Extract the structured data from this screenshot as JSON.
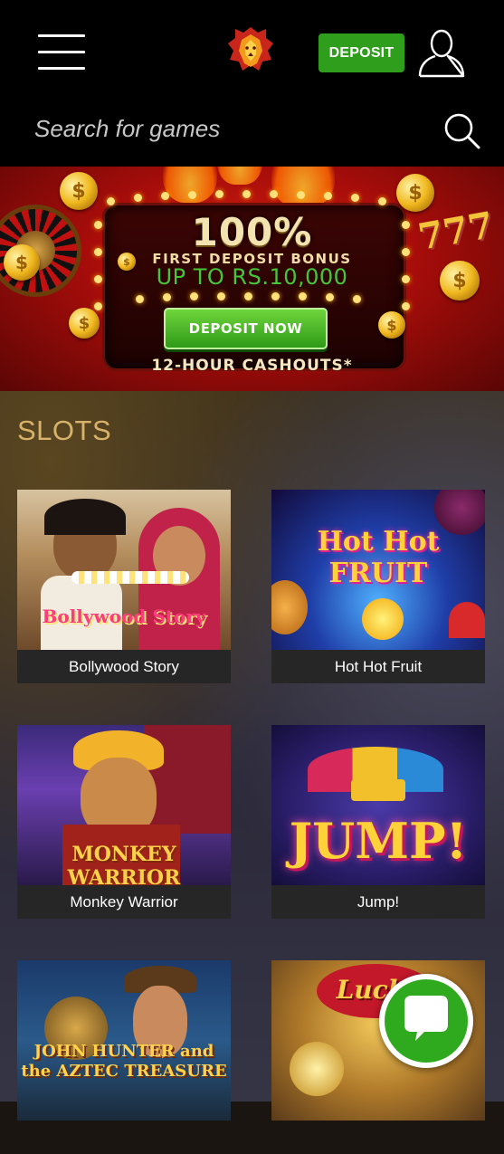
{
  "header": {
    "menu_icon": "hamburger-menu-icon",
    "logo_icon": "lion-logo-icon",
    "deposit_label": "DEPOSIT",
    "user_icon": "user-profile-icon",
    "search_placeholder": "Search for games",
    "search_icon": "search-icon"
  },
  "banner": {
    "headline": "100%",
    "subheadline": "FIRST DEPOSIT BONUS",
    "amount": "UP TO RS.10,000",
    "cta_label": "DEPOSIT NOW",
    "footer": "12-HOUR CASHOUTS*",
    "colors": {
      "background": "#b8120c",
      "cta": "#3faf22",
      "amount": "#46c63a"
    }
  },
  "slots": {
    "title": "SLOTS",
    "games": [
      {
        "name": "Bollywood Story",
        "thumb_text": "Bollywood Story"
      },
      {
        "name": "Hot Hot Fruit",
        "thumb_text": "Hot Hot FRUIT"
      },
      {
        "name": "Monkey Warrior",
        "thumb_text": "MONKEY WARRIOR"
      },
      {
        "name": "Jump!",
        "thumb_text": "JUMP!"
      },
      {
        "name": "",
        "thumb_text": "JOHN HUNTER and the AZTEC TREASURE"
      },
      {
        "name": "",
        "thumb_text": "Lucky"
      }
    ]
  },
  "chat": {
    "icon": "chat-bubble-icon",
    "color": "#2faa1e"
  },
  "colors": {
    "accent_green": "#2f9e1c",
    "section_title": "#d8b26a",
    "label_bg": "#262626"
  }
}
